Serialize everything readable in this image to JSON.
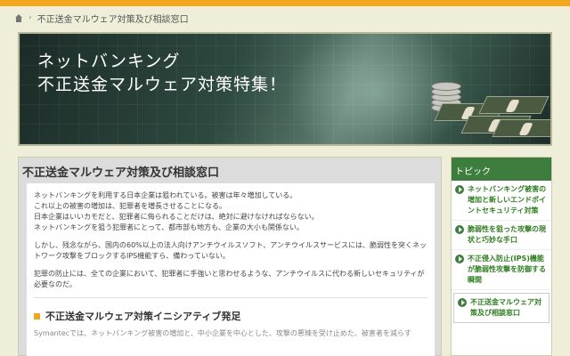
{
  "breadcrumb": {
    "current": "不正送金マルウェア対策及び相談窓口"
  },
  "banner": {
    "line1": "ネットバンキング",
    "line2": "不正送金マルウェア対策特集！"
  },
  "main": {
    "title": "不正送金マルウェア対策及び相談窓口",
    "paragraphs": [
      "ネットバンキングを利用する日本企業は狙われている。被害は年々増加している。",
      "これ以上の被害の増加は、犯罪者を増長させることになる。",
      "日本企業はいいカモだと、犯罪者に侮られることだけは、絶対に避けなければならない。",
      "ネットバンキングを狙う犯罪者にとって、都市部も地方も、企業の大小も関係ない。",
      "しかし、残念ながら、国内の60%以上の法人向けアンチウイルスソフト、アンチウイルスサービスには、脆弱性を突くネットワーク攻撃をブロックするIPS機能すら、備わっていない。",
      "犯罪の防止には、全ての企業において、犯罪者に手強いと思わせるような、アンチウイルスに代わる新しいセキュリティが必要なのだ。"
    ],
    "subheading": "不正送金マルウェア対策イニシアティブ発足",
    "continued": "Symantecでは、ネットバンキング被害の増加と、中小企業を中心とした、攻撃の悪辣を受け止めた、被害者を減らす"
  },
  "sidebar": {
    "title": "トピック",
    "items": [
      {
        "label": "ネットバンキング被害の増加と新しいエンドポイントセキュリティ対策"
      },
      {
        "label": "脆弱性を狙った攻撃の現状と巧妙な手口"
      },
      {
        "label": "不正侵入防止(IPS)機能が脆弱性攻撃を防御する瞬間"
      },
      {
        "label": "不正送金マルウェア対策及び相談窓口"
      }
    ]
  },
  "colors": {
    "accent": "#f2a81d",
    "sidebar_green": "#3d7d3d",
    "link_green": "#2e7d1f"
  }
}
